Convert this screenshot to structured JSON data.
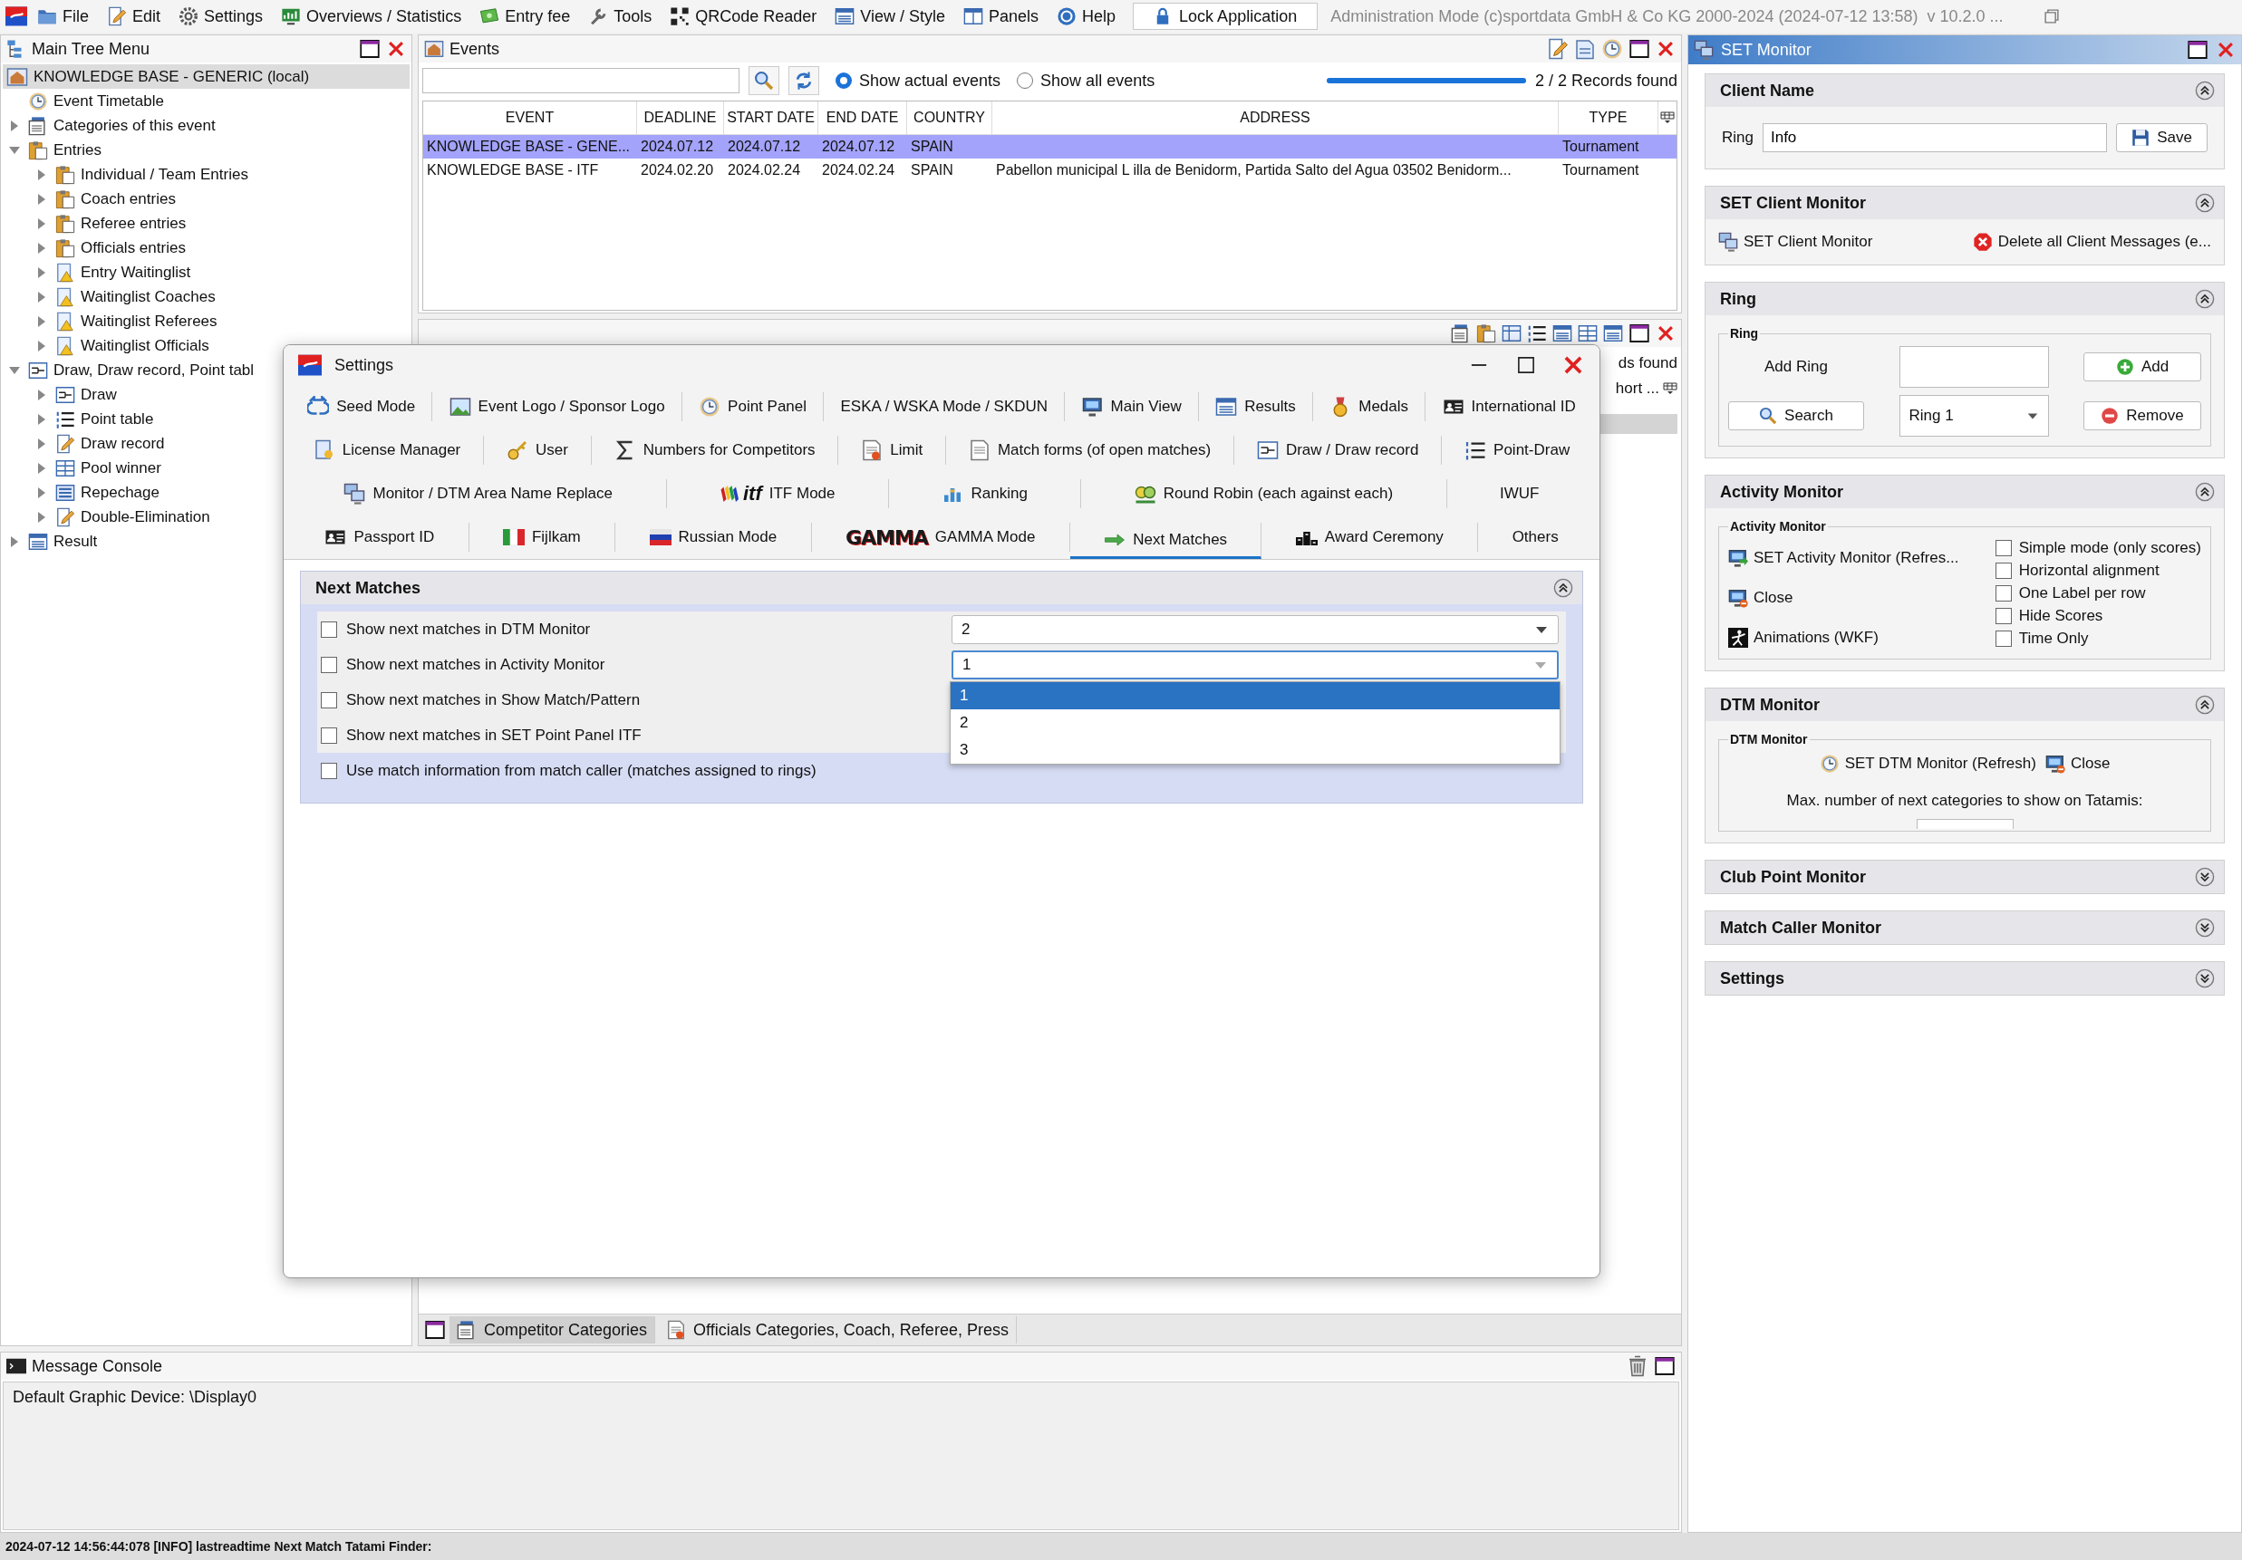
{
  "menu_bar": {
    "items": [
      {
        "label": "File",
        "kind": "folder"
      },
      {
        "label": "Edit",
        "kind": "edit"
      },
      {
        "label": "Settings",
        "kind": "gear"
      },
      {
        "label": "Overviews / Statistics",
        "kind": "chart"
      },
      {
        "label": "Entry fee",
        "kind": "money"
      },
      {
        "label": "Tools",
        "kind": "wrench"
      },
      {
        "label": "QRCode Reader",
        "kind": "qr"
      },
      {
        "label": "View / Style",
        "kind": "window"
      },
      {
        "label": "Panels",
        "kind": "panels"
      },
      {
        "label": "Help",
        "kind": "help"
      }
    ],
    "lock_button": "Lock Application",
    "mode_text": "Administration Mode (c)sportdata GmbH & Co KG 2000-2024 (2024-07-12 13:58)  v 10.2.0 ..."
  },
  "main_tree": {
    "title": "Main Tree Menu",
    "root": {
      "label": "KNOWLEDGE BASE - GENERIC (local)",
      "selected": true
    },
    "items": [
      {
        "label": "Event Timetable",
        "kind": "clock",
        "selected": false
      },
      {
        "label": "Categories of this event",
        "kind": "categories",
        "selected": false,
        "expanded": false
      },
      {
        "label": "Entries",
        "kind": "clipboard",
        "selected": false,
        "expanded": true,
        "children": [
          {
            "label": "Individual / Team Entries",
            "kind": "clipboard",
            "selected": false,
            "expanded": false
          },
          {
            "label": "Coach entries",
            "kind": "clipboard",
            "selected": false,
            "expanded": false
          },
          {
            "label": "Referee entries",
            "kind": "clipboard",
            "selected": false,
            "expanded": false
          },
          {
            "label": "Officials entries",
            "kind": "clipboard",
            "selected": false,
            "expanded": false
          },
          {
            "label": "Entry Waitinglist",
            "kind": "warning-doc",
            "selected": false,
            "expanded": false
          },
          {
            "label": "Waitinglist Coaches",
            "kind": "warning-doc",
            "selected": false,
            "expanded": false
          },
          {
            "label": "Waitinglist Referees",
            "kind": "warning-doc",
            "selected": false,
            "expanded": false
          },
          {
            "label": "Waitinglist Officials",
            "kind": "warning-doc",
            "selected": false,
            "expanded": false
          }
        ]
      },
      {
        "label": "Draw, Draw record, Point tabl",
        "kind": "draw",
        "selected": false,
        "expanded": true,
        "children": [
          {
            "label": "Draw",
            "kind": "draw",
            "selected": false,
            "expanded": false
          },
          {
            "label": "Point table",
            "kind": "point-table",
            "selected": false,
            "expanded": false
          },
          {
            "label": "Draw record",
            "kind": "draw-record",
            "selected": false,
            "expanded": false
          },
          {
            "label": "Pool winner",
            "kind": "pool",
            "selected": false,
            "expanded": false
          },
          {
            "label": "Repechage",
            "kind": "repechage",
            "selected": false,
            "expanded": false
          },
          {
            "label": "Double-Elimination",
            "kind": "draw-record",
            "selected": false,
            "expanded": false
          }
        ]
      },
      {
        "label": "Result",
        "kind": "result",
        "selected": false,
        "expanded": false
      }
    ]
  },
  "events": {
    "title": "Events",
    "radios": [
      {
        "label": "Show actual events",
        "selected": true
      },
      {
        "label": "Show all events",
        "selected": false
      }
    ],
    "progress": {
      "level": 1
    },
    "records": "2 / 2 Records found",
    "columns": [
      "EVENT",
      "DEADLINE",
      "START DATE",
      "END DATE",
      "COUNTRY",
      "ADDRESS",
      "TYPE"
    ],
    "rows": [
      {
        "selected": true,
        "event": "KNOWLEDGE BASE - GENE...",
        "deadline": "2024.07.12",
        "start_date": "2024.07.12",
        "end_date": "2024.07.12",
        "country": "SPAIN",
        "type": "Tournament"
      },
      {
        "selected": false,
        "event": "KNOWLEDGE BASE - ITF",
        "deadline": "2024.02.20",
        "start_date": "2024.02.24",
        "end_date": "2024.02.24",
        "country": "SPAIN",
        "address": "Pabellon municipal L illa de Benidorm, Partida Salto del Agua 03502 Benidorm...",
        "type": "Tournament"
      }
    ]
  },
  "competitor_panel": {
    "records_fragment": "ds found",
    "column_fragment": "hort ...",
    "tabs": [
      {
        "label": "Competitor Categories",
        "selected": true
      },
      {
        "label": "Officials Categories, Coach, Referee, Press",
        "selected": false
      }
    ]
  },
  "settings_dialog": {
    "title": "Settings",
    "tab_rows": [
      {
        "tabs": [
          {
            "label": "Seed Mode",
            "kind": "seed",
            "selected": false
          },
          {
            "label": "Event Logo / Sponsor Logo",
            "kind": "image",
            "selected": false
          },
          {
            "label": "Point Panel",
            "kind": "clock",
            "selected": false
          },
          {
            "label": "ESKA / WSKA Mode / SKDUN",
            "kind": "none",
            "selected": false
          },
          {
            "label": "Main View",
            "kind": "monitor",
            "selected": false
          },
          {
            "label": "Results",
            "kind": "results",
            "selected": false
          },
          {
            "label": "Medals",
            "kind": "medal",
            "selected": false
          },
          {
            "label": "International ID",
            "kind": "id-card",
            "selected": false
          }
        ]
      },
      {
        "tabs": [
          {
            "label": "License Manager",
            "kind": "license",
            "selected": false
          },
          {
            "label": "User",
            "kind": "key",
            "selected": false
          },
          {
            "label": "Numbers for Competitors",
            "kind": "sigma",
            "selected": false
          },
          {
            "label": "Limit",
            "kind": "limit",
            "selected": false
          },
          {
            "label": "Match forms (of open matches)",
            "kind": "doc",
            "selected": false
          },
          {
            "label": "Draw / Draw record",
            "kind": "draw",
            "selected": false
          },
          {
            "label": "Point-Draw",
            "kind": "point-table",
            "selected": false
          }
        ]
      },
      {
        "tabs": [
          {
            "label": "Monitor / DTM Area Name Replace",
            "kind": "monitors",
            "selected": false
          },
          {
            "label": "ITF Mode",
            "kind": "itf",
            "logo": "itf",
            "selected": false
          },
          {
            "label": "Ranking",
            "kind": "ranking",
            "selected": false
          },
          {
            "label": "Round Robin (each against each)",
            "kind": "round-robin",
            "selected": false
          },
          {
            "label": "IWUF",
            "kind": "none",
            "selected": false
          }
        ]
      },
      {
        "tabs": [
          {
            "label": "Passport ID",
            "kind": "id-card",
            "selected": false
          },
          {
            "label": "Fijlkam",
            "kind": "flag-it",
            "selected": false
          },
          {
            "label": "Russian Mode",
            "kind": "flag-ru",
            "selected": false
          },
          {
            "label": "GAMMA Mode",
            "kind": "gamma",
            "logo": "GAMMA",
            "selected": false
          },
          {
            "label": "Next Matches",
            "kind": "arrow",
            "selected": true
          },
          {
            "label": "Award Ceremony",
            "kind": "podium",
            "selected": false
          },
          {
            "label": "Others",
            "kind": "none",
            "selected": false
          }
        ]
      }
    ],
    "panel": {
      "title": "Next Matches",
      "expanded": true,
      "options": [
        {
          "label": "Show next matches in DTM Monitor",
          "checked": false,
          "dropdown": {
            "value": "2",
            "open": false
          }
        },
        {
          "label": "Show next matches in Activity Monitor",
          "checked": false,
          "dropdown": {
            "value": "1",
            "open": true,
            "options": [
              {
                "label": "1",
                "selected": true
              },
              {
                "label": "2",
                "selected": false
              },
              {
                "label": "3",
                "selected": false
              }
            ]
          }
        },
        {
          "label": "Show next matches in Show Match/Pattern",
          "checked": false
        },
        {
          "label": "Show next matches in SET Point Panel ITF",
          "checked": false
        },
        {
          "label": "Use match information from match caller (matches assigned to rings)",
          "checked": false
        }
      ]
    }
  },
  "set_monitor": {
    "title": "SET Monitor",
    "sections": [
      {
        "title": "Client Name",
        "expanded": true,
        "kind": "client",
        "label": "Ring",
        "value": "Info",
        "button": "Save"
      },
      {
        "title": "SET Client Monitor",
        "expanded": true,
        "kind": "links",
        "links": [
          {
            "label": "SET Client Monitor",
            "kind": "monitors"
          },
          {
            "label": "Delete all Client Messages (e...",
            "kind": "delete"
          }
        ]
      },
      {
        "title": "Ring",
        "expanded": true,
        "kind": "ring",
        "group": "Ring",
        "add_label": "Add Ring",
        "add_button": "Add",
        "search_button": "Search",
        "ring_select": "Ring 1",
        "remove_button": "Remove"
      },
      {
        "title": "Activity Monitor",
        "expanded": true,
        "kind": "activity",
        "group": "Activity Monitor",
        "actions": [
          {
            "label": "SET Activity Monitor (Refres...",
            "kind": "monitor-go"
          },
          {
            "label": "Close",
            "kind": "monitor-close"
          },
          {
            "label": "Animations (WKF)",
            "kind": "animation"
          }
        ],
        "checkboxes": [
          {
            "label": "Simple mode (only scores)",
            "checked": false
          },
          {
            "label": "Horizontal alignment",
            "checked": false
          },
          {
            "label": "One Label per row",
            "checked": false
          },
          {
            "label": "Hide Scores",
            "checked": false
          },
          {
            "label": "Time Only",
            "checked": false
          }
        ]
      },
      {
        "title": "DTM Monitor",
        "expanded": true,
        "kind": "dtm",
        "group": "DTM Monitor",
        "actions": [
          {
            "label": "SET DTM Monitor (Refresh)",
            "kind": "clock"
          },
          {
            "label": "Close",
            "kind": "monitor-close"
          }
        ],
        "note": "Max. number of next categories to show on Tatamis:"
      },
      {
        "title": "Club Point Monitor",
        "expanded": false
      },
      {
        "title": "Match Caller Monitor",
        "expanded": false
      },
      {
        "title": "Settings",
        "expanded": false
      }
    ]
  },
  "message_console": {
    "title": "Message Console",
    "lines": [
      "Default Graphic Device: \\Display0"
    ]
  },
  "status_bar": {
    "text": "2024-07-12 14:56:44:078 [INFO] lastreadtime Next Match Tatami Finder:"
  }
}
